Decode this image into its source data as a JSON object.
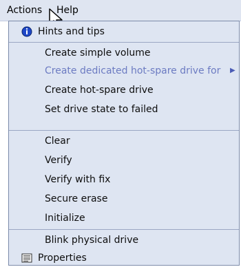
{
  "menubar": {
    "actions_label": "Actions",
    "help_label": "Help"
  },
  "menu": {
    "items": [
      {
        "label": "Hints and tips",
        "icon": "info-icon"
      },
      {
        "label": "Create simple volume"
      },
      {
        "label": "Create dedicated hot-spare drive for",
        "disabled": true,
        "has_submenu": true
      },
      {
        "label": "Create hot-spare drive"
      },
      {
        "label": "Set drive state to failed"
      },
      {
        "label": "Clear"
      },
      {
        "label": "Verify"
      },
      {
        "label": "Verify with fix"
      },
      {
        "label": "Secure erase"
      },
      {
        "label": "Initialize"
      },
      {
        "label": "Blink physical drive"
      },
      {
        "label": "Properties",
        "icon": "properties-icon"
      }
    ]
  },
  "colors": {
    "menu_background": "#dee5f2",
    "disabled_text": "#6c7bc2",
    "info_icon_blue": "#1f48c8"
  }
}
